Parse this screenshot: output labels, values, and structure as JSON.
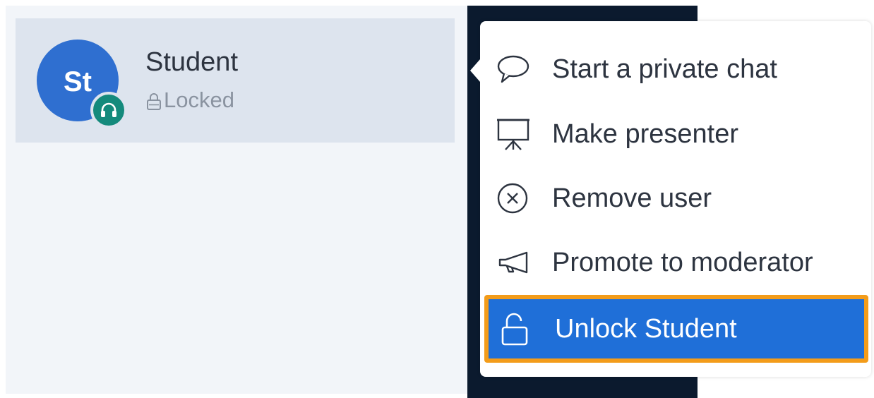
{
  "user": {
    "initials": "St",
    "name": "Student",
    "status": "Locked"
  },
  "menu": {
    "items": [
      {
        "label": "Start a private chat",
        "icon": "chat-bubble-icon"
      },
      {
        "label": "Make presenter",
        "icon": "presentation-board-icon"
      },
      {
        "label": "Remove user",
        "icon": "close-circle-icon"
      },
      {
        "label": "Promote to moderator",
        "icon": "megaphone-icon"
      },
      {
        "label": "Unlock Student",
        "icon": "unlock-icon",
        "highlighted": true
      }
    ]
  },
  "colors": {
    "avatar": "#2f6fd0",
    "badge": "#148a7c",
    "highlight": "#1f6fd8",
    "highlight_border": "#f39c1a",
    "row_selected": "#dde4ee",
    "panel": "#f2f5f9",
    "dark_strip": "#0b1a2e"
  }
}
